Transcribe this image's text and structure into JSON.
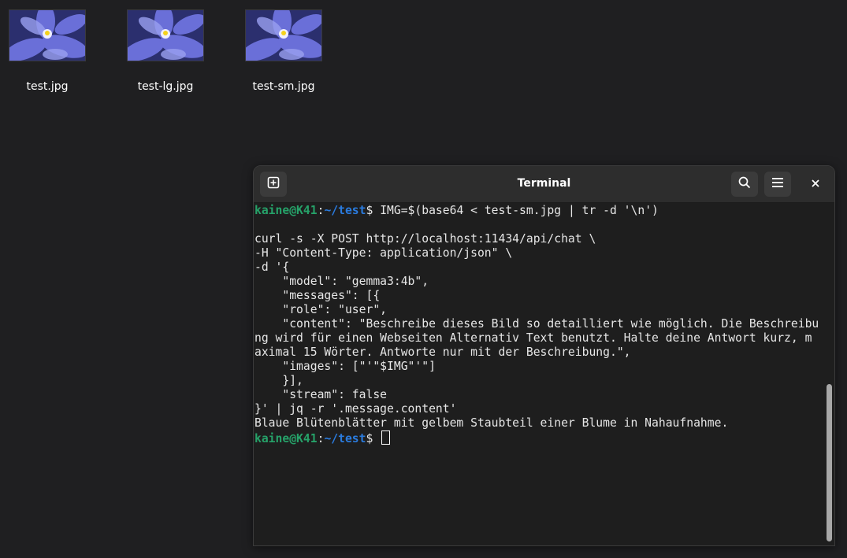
{
  "desktop": {
    "files": [
      {
        "name": "test.jpg"
      },
      {
        "name": "test-lg.jpg"
      },
      {
        "name": "test-sm.jpg"
      }
    ]
  },
  "terminal": {
    "title": "Terminal",
    "buttons": {
      "new_tab": "new-tab-icon",
      "search": "search-icon",
      "menu": "hamburger-menu-icon",
      "close": "close-icon"
    },
    "prompt": {
      "user": "kaine@K41",
      "sep": ":",
      "path": "~/test",
      "symbol": "$ "
    },
    "command": "IMG=$(base64 < test-sm.jpg | tr -d '\\n')",
    "lines": [
      "",
      "curl -s -X POST http://localhost:11434/api/chat \\",
      "-H \"Content-Type: application/json\" \\",
      "-d '{",
      "    \"model\": \"gemma3:4b\",",
      "    \"messages\": [{",
      "    \"role\": \"user\",",
      "    \"content\": \"Beschreibe dieses Bild so detailliert wie möglich. Die Beschreibu",
      "ng wird für einen Webseiten Alternativ Text benutzt. Halte deine Antwort kurz, m",
      "aximal 15 Wörter. Antworte nur mit der Beschreibung.\",",
      "    \"images\": [\"'\"$IMG\"'\"]",
      "    }],",
      "    \"stream\": false",
      "}' | jq -r '.message.content'",
      "Blaue Blütenblätter mit gelbem Staubteil einer Blume in Nahaufnahme."
    ]
  },
  "colors": {
    "prompt_user": "#26a269",
    "prompt_path": "#2a7bde",
    "background": "#1e1e1e"
  }
}
